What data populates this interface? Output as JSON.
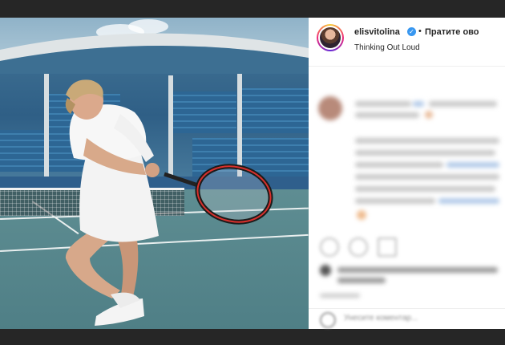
{
  "post": {
    "username": "elisvitolina",
    "follow_label": "Пратите ово",
    "separator": "•",
    "location": "Thinking Out Loud"
  },
  "comment_box": {
    "placeholder": "Унесите коментар..."
  },
  "icons": {
    "verified": "verified-badge-icon",
    "like": "heart-icon",
    "comment": "comment-icon",
    "share": "share-icon",
    "emoji": "smile-icon"
  },
  "colors": {
    "verified_blue": "#3897f0",
    "text": "#262626",
    "muted": "#8e8e8e",
    "background": "#262626"
  }
}
